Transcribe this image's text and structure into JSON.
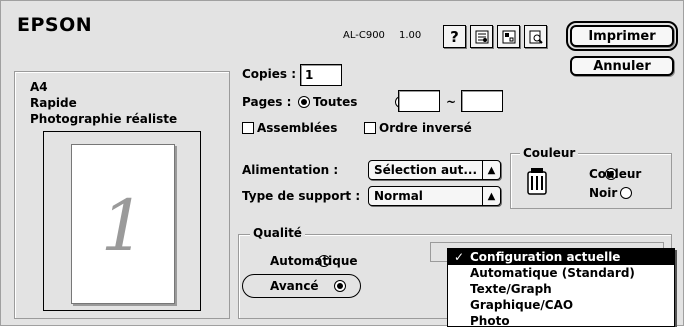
{
  "header": {
    "brand": "EPSON",
    "model": "AL-C900",
    "version": "1.00",
    "icons": [
      "help-icon",
      "watermark-icon",
      "layout-icon",
      "preview-icon"
    ]
  },
  "actions": {
    "print": "Imprimer",
    "cancel": "Annuler"
  },
  "summary": {
    "paper": "A4",
    "speed": "Rapide",
    "mode": "Photographie réaliste",
    "preview_digit": "1"
  },
  "copies": {
    "label": "Copies :",
    "value": "1"
  },
  "pages": {
    "label": "Pages :",
    "all": "Toutes",
    "all_selected": true,
    "from": "",
    "separator": "~",
    "to": ""
  },
  "collate": {
    "label": "Assemblées",
    "checked": false
  },
  "reverse": {
    "label": "Ordre inversé",
    "checked": false
  },
  "source": {
    "label": "Alimentation :",
    "value": "Sélection aut..."
  },
  "media": {
    "label": "Type de support :",
    "value": "Normal"
  },
  "color": {
    "title": "Couleur",
    "options": [
      "Couleur",
      "Noir"
    ],
    "selected": "Couleur"
  },
  "quality": {
    "title": "Qualité",
    "automatic": "Automatique",
    "advanced": "Avancé",
    "selected": "Avancé"
  },
  "quality_menu": {
    "items": [
      "Configuration actuelle",
      "Automatique (Standard)",
      "Texte/Graph",
      "Graphique/CAO",
      "Photo"
    ],
    "selected_index": 0
  }
}
